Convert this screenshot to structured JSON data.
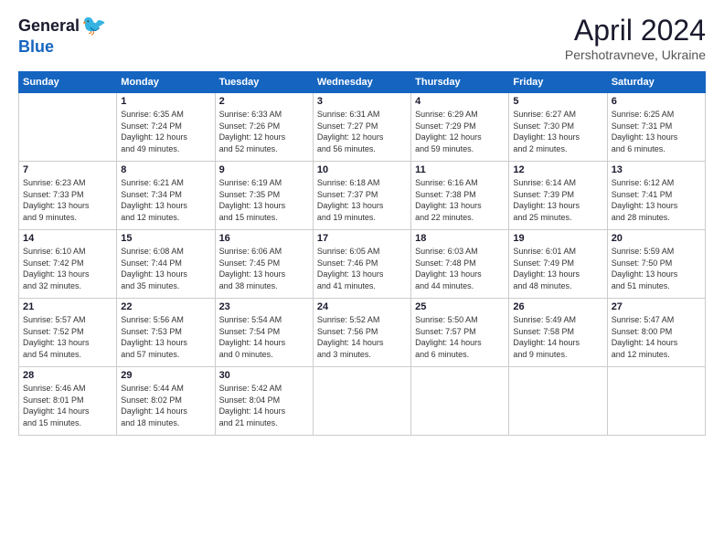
{
  "header": {
    "logo_general": "General",
    "logo_blue": "Blue",
    "month_title": "April 2024",
    "location": "Pershotravneve, Ukraine"
  },
  "weekdays": [
    "Sunday",
    "Monday",
    "Tuesday",
    "Wednesday",
    "Thursday",
    "Friday",
    "Saturday"
  ],
  "weeks": [
    [
      {
        "day": "",
        "info": ""
      },
      {
        "day": "1",
        "info": "Sunrise: 6:35 AM\nSunset: 7:24 PM\nDaylight: 12 hours\nand 49 minutes."
      },
      {
        "day": "2",
        "info": "Sunrise: 6:33 AM\nSunset: 7:26 PM\nDaylight: 12 hours\nand 52 minutes."
      },
      {
        "day": "3",
        "info": "Sunrise: 6:31 AM\nSunset: 7:27 PM\nDaylight: 12 hours\nand 56 minutes."
      },
      {
        "day": "4",
        "info": "Sunrise: 6:29 AM\nSunset: 7:29 PM\nDaylight: 12 hours\nand 59 minutes."
      },
      {
        "day": "5",
        "info": "Sunrise: 6:27 AM\nSunset: 7:30 PM\nDaylight: 13 hours\nand 2 minutes."
      },
      {
        "day": "6",
        "info": "Sunrise: 6:25 AM\nSunset: 7:31 PM\nDaylight: 13 hours\nand 6 minutes."
      }
    ],
    [
      {
        "day": "7",
        "info": "Sunrise: 6:23 AM\nSunset: 7:33 PM\nDaylight: 13 hours\nand 9 minutes."
      },
      {
        "day": "8",
        "info": "Sunrise: 6:21 AM\nSunset: 7:34 PM\nDaylight: 13 hours\nand 12 minutes."
      },
      {
        "day": "9",
        "info": "Sunrise: 6:19 AM\nSunset: 7:35 PM\nDaylight: 13 hours\nand 15 minutes."
      },
      {
        "day": "10",
        "info": "Sunrise: 6:18 AM\nSunset: 7:37 PM\nDaylight: 13 hours\nand 19 minutes."
      },
      {
        "day": "11",
        "info": "Sunrise: 6:16 AM\nSunset: 7:38 PM\nDaylight: 13 hours\nand 22 minutes."
      },
      {
        "day": "12",
        "info": "Sunrise: 6:14 AM\nSunset: 7:39 PM\nDaylight: 13 hours\nand 25 minutes."
      },
      {
        "day": "13",
        "info": "Sunrise: 6:12 AM\nSunset: 7:41 PM\nDaylight: 13 hours\nand 28 minutes."
      }
    ],
    [
      {
        "day": "14",
        "info": "Sunrise: 6:10 AM\nSunset: 7:42 PM\nDaylight: 13 hours\nand 32 minutes."
      },
      {
        "day": "15",
        "info": "Sunrise: 6:08 AM\nSunset: 7:44 PM\nDaylight: 13 hours\nand 35 minutes."
      },
      {
        "day": "16",
        "info": "Sunrise: 6:06 AM\nSunset: 7:45 PM\nDaylight: 13 hours\nand 38 minutes."
      },
      {
        "day": "17",
        "info": "Sunrise: 6:05 AM\nSunset: 7:46 PM\nDaylight: 13 hours\nand 41 minutes."
      },
      {
        "day": "18",
        "info": "Sunrise: 6:03 AM\nSunset: 7:48 PM\nDaylight: 13 hours\nand 44 minutes."
      },
      {
        "day": "19",
        "info": "Sunrise: 6:01 AM\nSunset: 7:49 PM\nDaylight: 13 hours\nand 48 minutes."
      },
      {
        "day": "20",
        "info": "Sunrise: 5:59 AM\nSunset: 7:50 PM\nDaylight: 13 hours\nand 51 minutes."
      }
    ],
    [
      {
        "day": "21",
        "info": "Sunrise: 5:57 AM\nSunset: 7:52 PM\nDaylight: 13 hours\nand 54 minutes."
      },
      {
        "day": "22",
        "info": "Sunrise: 5:56 AM\nSunset: 7:53 PM\nDaylight: 13 hours\nand 57 minutes."
      },
      {
        "day": "23",
        "info": "Sunrise: 5:54 AM\nSunset: 7:54 PM\nDaylight: 14 hours\nand 0 minutes."
      },
      {
        "day": "24",
        "info": "Sunrise: 5:52 AM\nSunset: 7:56 PM\nDaylight: 14 hours\nand 3 minutes."
      },
      {
        "day": "25",
        "info": "Sunrise: 5:50 AM\nSunset: 7:57 PM\nDaylight: 14 hours\nand 6 minutes."
      },
      {
        "day": "26",
        "info": "Sunrise: 5:49 AM\nSunset: 7:58 PM\nDaylight: 14 hours\nand 9 minutes."
      },
      {
        "day": "27",
        "info": "Sunrise: 5:47 AM\nSunset: 8:00 PM\nDaylight: 14 hours\nand 12 minutes."
      }
    ],
    [
      {
        "day": "28",
        "info": "Sunrise: 5:46 AM\nSunset: 8:01 PM\nDaylight: 14 hours\nand 15 minutes."
      },
      {
        "day": "29",
        "info": "Sunrise: 5:44 AM\nSunset: 8:02 PM\nDaylight: 14 hours\nand 18 minutes."
      },
      {
        "day": "30",
        "info": "Sunrise: 5:42 AM\nSunset: 8:04 PM\nDaylight: 14 hours\nand 21 minutes."
      },
      {
        "day": "",
        "info": ""
      },
      {
        "day": "",
        "info": ""
      },
      {
        "day": "",
        "info": ""
      },
      {
        "day": "",
        "info": ""
      }
    ]
  ]
}
